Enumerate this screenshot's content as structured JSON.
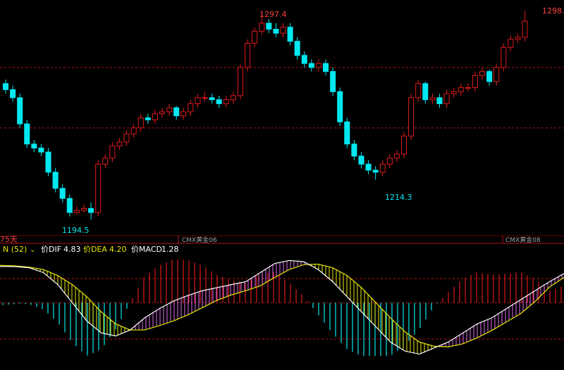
{
  "chart_data": [
    {
      "type": "candlestick",
      "name": "CMX黄金",
      "colors": {
        "up": "#e0191c",
        "down": "#00e8f0",
        "grid": "#b3121a"
      },
      "annotations": {
        "high_left": "1297.4",
        "high_right": "1298.",
        "low_mid": "1214.3",
        "low_left": "1194.5"
      },
      "axis_labels": {
        "left_period": "75天",
        "contract_1": "CMX黄金06",
        "contract_2": "CMX黄金08"
      },
      "x": [
        1,
        2,
        3,
        4,
        5,
        6,
        7,
        8,
        9,
        10,
        11,
        12,
        13,
        14,
        15,
        16,
        17,
        18,
        19,
        20,
        21,
        22,
        23,
        24,
        25,
        26,
        27,
        28,
        29,
        30,
        31,
        32,
        33,
        34,
        35,
        36,
        37,
        38,
        39,
        40,
        41,
        42,
        43,
        44,
        45,
        46,
        47,
        48,
        49,
        50,
        51,
        52,
        53,
        54,
        55,
        56,
        57,
        58,
        59,
        60,
        61,
        62,
        63,
        64,
        65,
        66,
        67,
        68,
        69,
        70,
        71,
        72,
        73,
        74,
        75,
        76,
        77,
        78,
        79
      ],
      "open": [
        1262,
        1259,
        1255,
        1242,
        1232,
        1230,
        1228,
        1218,
        1210,
        1205,
        1198,
        1199,
        1200,
        1198,
        1222,
        1225,
        1231,
        1233,
        1237,
        1240,
        1245,
        1244,
        1247,
        1248,
        1250,
        1246,
        1248,
        1252,
        1255,
        1255,
        1254,
        1252,
        1254,
        1256,
        1270,
        1282,
        1288,
        1292,
        1289,
        1287,
        1290,
        1283,
        1276,
        1272,
        1270,
        1272,
        1268,
        1258,
        1243,
        1232,
        1226,
        1222,
        1219,
        1218,
        1222,
        1225,
        1227,
        1236,
        1255,
        1262,
        1254,
        1255,
        1252,
        1257,
        1258,
        1260,
        1260,
        1266,
        1268,
        1263,
        1270,
        1280,
        1284,
        1285
      ],
      "close": [
        1259,
        1255,
        1242,
        1232,
        1230,
        1228,
        1218,
        1210,
        1205,
        1198,
        1199,
        1200,
        1198,
        1222,
        1225,
        1231,
        1233,
        1237,
        1240,
        1245,
        1244,
        1247,
        1248,
        1250,
        1246,
        1248,
        1252,
        1255,
        1255,
        1254,
        1252,
        1254,
        1256,
        1270,
        1282,
        1288,
        1292,
        1289,
        1287,
        1290,
        1283,
        1276,
        1272,
        1270,
        1272,
        1268,
        1258,
        1243,
        1232,
        1226,
        1222,
        1219,
        1218,
        1222,
        1225,
        1227,
        1236,
        1255,
        1262,
        1254,
        1255,
        1252,
        1257,
        1258,
        1260,
        1260,
        1266,
        1268,
        1263,
        1270,
        1280,
        1284,
        1285,
        1293
      ],
      "high": [
        1264,
        1261,
        1257,
        1244,
        1234,
        1232,
        1230,
        1220,
        1212,
        1207,
        1201,
        1202,
        1203,
        1224,
        1227,
        1233,
        1235,
        1239,
        1242,
        1247,
        1247,
        1249,
        1250,
        1252,
        1251,
        1250,
        1254,
        1257,
        1258,
        1257,
        1256,
        1256,
        1258,
        1272,
        1284,
        1290,
        1297.4,
        1294,
        1292,
        1292,
        1292,
        1285,
        1278,
        1274,
        1274,
        1274,
        1270,
        1260,
        1245,
        1234,
        1228,
        1224,
        1221,
        1224,
        1227,
        1229,
        1238,
        1257,
        1264,
        1263,
        1257,
        1257,
        1259,
        1260,
        1262,
        1262,
        1268,
        1270,
        1269,
        1272,
        1282,
        1286,
        1287,
        1298
      ],
      "low": [
        1257,
        1253,
        1240,
        1230,
        1228,
        1226,
        1216,
        1208,
        1203,
        1196,
        1197,
        1198,
        1194.5,
        1196,
        1220,
        1223,
        1229,
        1231,
        1235,
        1238,
        1242,
        1242,
        1245,
        1246,
        1244,
        1244,
        1246,
        1250,
        1253,
        1252,
        1250,
        1250,
        1252,
        1254,
        1268,
        1280,
        1286,
        1287,
        1285,
        1285,
        1281,
        1274,
        1270,
        1268,
        1268,
        1266,
        1256,
        1241,
        1230,
        1224,
        1220,
        1217,
        1214.3,
        1216,
        1220,
        1223,
        1225,
        1234,
        1253,
        1252,
        1252,
        1250,
        1250,
        1255,
        1256,
        1258,
        1258,
        1264,
        1261,
        1261,
        1268,
        1278,
        1282,
        1283
      ]
    },
    {
      "type": "macd",
      "legend": {
        "period_text": "N (52)",
        "dif_label": "价DIF",
        "dif_value": "4.83",
        "dea_label": "价DEA",
        "dea_value": "4.20",
        "macd_label": "价MACD",
        "macd_value": "1.28"
      },
      "colors": {
        "dif": "#ffffff",
        "dea": "#e8e800",
        "pos_bar": "#e0191c",
        "neg_bar": "#00e8f0",
        "fill_up": "#e070f0",
        "fill_down": "#e8e800"
      },
      "x": [
        1,
        3,
        5,
        7,
        9,
        11,
        13,
        15,
        17,
        19,
        21,
        23,
        25,
        27,
        29,
        31,
        33,
        35,
        37,
        39,
        41,
        43,
        45,
        47,
        49,
        51,
        53,
        55,
        57,
        59,
        61,
        63,
        65,
        67,
        69,
        71,
        73,
        75,
        77,
        79
      ],
      "dif": [
        6.0,
        6.0,
        5.8,
        5.0,
        3.0,
        0.0,
        -3.0,
        -5.0,
        -5.5,
        -4.5,
        -2.5,
        -1.0,
        0.3,
        1.2,
        2.0,
        2.5,
        3.0,
        3.5,
        5.0,
        6.5,
        7.0,
        6.8,
        5.5,
        3.5,
        1.0,
        -1.5,
        -4.0,
        -6.5,
        -8.0,
        -8.5,
        -7.5,
        -6.5,
        -5.0,
        -3.5,
        -2.5,
        -1.0,
        0.5,
        2.0,
        3.5,
        4.83
      ],
      "dea": [
        6.2,
        6.1,
        5.9,
        5.5,
        4.5,
        3.0,
        1.0,
        -1.5,
        -3.5,
        -4.5,
        -4.5,
        -3.8,
        -3.0,
        -2.0,
        -0.8,
        0.4,
        1.3,
        2.0,
        2.8,
        4.2,
        5.5,
        6.3,
        6.4,
        5.8,
        4.5,
        2.5,
        0.0,
        -2.5,
        -4.8,
        -6.5,
        -7.2,
        -7.3,
        -6.8,
        -5.8,
        -4.6,
        -3.2,
        -1.8,
        0.2,
        2.6,
        4.2
      ],
      "macd": [
        -0.2,
        -0.1,
        -0.1,
        -0.5,
        -1.5,
        -3.0,
        -4.0,
        -3.5,
        -2.0,
        0.0,
        2.0,
        2.8,
        3.3,
        3.2,
        2.8,
        2.1,
        1.7,
        1.5,
        2.2,
        2.3,
        1.5,
        0.5,
        -0.9,
        -2.3,
        -3.5,
        -4.0,
        -4.0,
        -4.0,
        -3.2,
        -2.0,
        -0.3,
        0.8,
        1.8,
        2.3,
        2.1,
        2.2,
        2.3,
        1.8,
        0.9,
        1.28
      ]
    }
  ]
}
